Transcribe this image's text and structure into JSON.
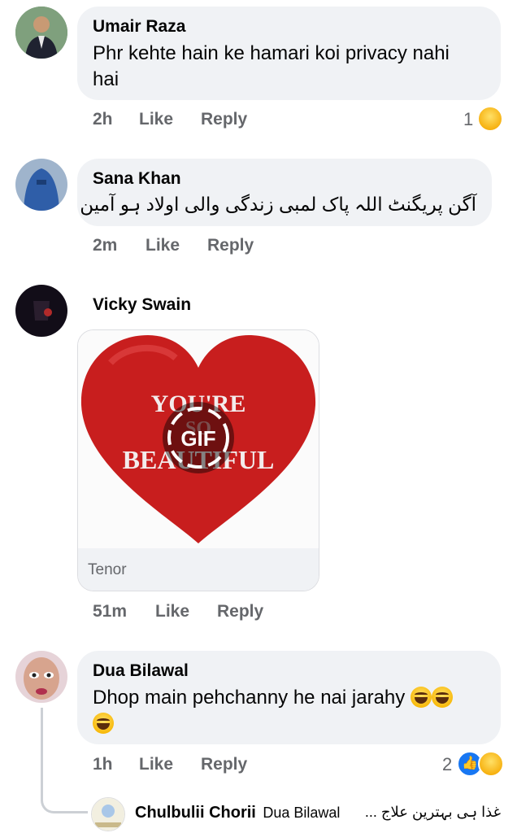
{
  "comments": [
    {
      "author": "Umair Raza",
      "text_line1": "Phr kehte hain ke hamari koi privacy nahi",
      "text_line2": "hai",
      "time": "2h",
      "like": "Like",
      "reply": "Reply",
      "reaction_count": "1"
    },
    {
      "author": "Sana Khan",
      "text": "آگن پریگنٹ اللہ پاک لمبی زندگی والی اولاد ہو آمین",
      "time": "2m",
      "like": "Like",
      "reply": "Reply"
    },
    {
      "author": "Vicky Swain",
      "gif_text_top": "YOU'RE",
      "gif_text_mid": "SO",
      "gif_text_bottom": "BEAUTIFUL",
      "gif_badge": "GIF",
      "gif_source": "Tenor",
      "time": "51m",
      "like": "Like",
      "reply": "Reply"
    },
    {
      "author": "Dua Bilawal",
      "text": "Dhop main pehchanny he nai jarahy",
      "time": "1h",
      "like": "Like",
      "reply": "Reply",
      "reaction_count": "2"
    }
  ],
  "reply_preview": {
    "author": "Chulbulii Chorii",
    "mention": "Dua Bilawal",
    "snippet": "غذا ہی بہترین علاج ..."
  },
  "colors": {
    "bubble": "#f0f2f5",
    "meta": "#65676b",
    "like_blue": "#1877f2",
    "heart_red": "#d42a2a"
  }
}
